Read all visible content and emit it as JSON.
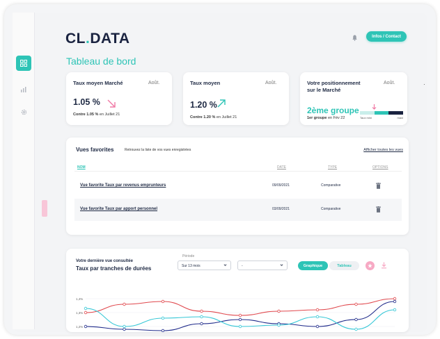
{
  "brand": {
    "logo_main": "CL",
    "logo_dot": ".",
    "logo_rest": "DATA"
  },
  "header": {
    "contact_label": "Infos / Contact"
  },
  "page": {
    "title": "Tableau de bord"
  },
  "sidebar": {
    "items": [
      {
        "icon": "grid-icon",
        "active": true
      },
      {
        "icon": "bar-chart-icon",
        "active": false
      },
      {
        "icon": "gear-icon",
        "active": false
      }
    ]
  },
  "kpis": [
    {
      "title": "Taux moyen Marché",
      "month": "Août.",
      "value": "1.05 %",
      "trend": "down",
      "sub_bold": "Contre 1.05 %",
      "sub_rest": " en Juillet 21"
    },
    {
      "title": "Taux moyen",
      "month": "Août.",
      "value": "1.20 %",
      "trend": "up",
      "sub_bold": "Contre 1.20 %",
      "sub_rest": " en Juillet 21"
    }
  ],
  "position": {
    "title": "Votre positionnement sur le Marché",
    "month": "Août.",
    "rank": "2ème groupe",
    "sub_bold": "1er groupe",
    "sub_rest": " en Fév 22",
    "bar_min": "Taux mini",
    "bar_max": "maxi"
  },
  "favorites": {
    "title": "Vues favorites",
    "description": "Retrouvez la liste de vos vues enregistrées",
    "show_all": "Afficher toutes les vues",
    "columns": [
      "NOM",
      "DATE",
      "TYPE",
      "OPTIONS"
    ],
    "rows": [
      {
        "name": "Vue favorite Taux par revenus emprunteurs",
        "date": "09/09/2021",
        "type": "Comparative"
      },
      {
        "name": "Vue favorite Taux par apport personnel",
        "date": "03/09/2021",
        "type": "Comparative"
      }
    ]
  },
  "last_view": {
    "subtitle": "Votre dernière vue consultée",
    "title": "Taux par tranches de durées",
    "period_label": "Période",
    "period_value": "Sur 13 mois",
    "second_value": "-",
    "graph_label": "Graphique",
    "table_label": "Tableau"
  },
  "colors": {
    "accent": "#2ec4b6",
    "pink": "#f7a9c4",
    "red": "#e0474c",
    "navy": "#1f2a8a",
    "cyan": "#35c7d6"
  },
  "chart_data": {
    "type": "line",
    "y_tick_labels": [
      "1,4%",
      "1,3%",
      "1,2%"
    ],
    "series": [
      {
        "color": "#e0474c",
        "values": [
          1.3,
          1.36,
          1.38,
          1.31,
          1.28,
          1.31,
          1.32,
          1.36,
          1.4
        ]
      },
      {
        "color": "#1f2a8a",
        "values": [
          1.2,
          1.18,
          1.17,
          1.22,
          1.25,
          1.22,
          1.2,
          1.25,
          1.38
        ]
      },
      {
        "color": "#35c7d6",
        "values": [
          1.33,
          1.2,
          1.26,
          1.27,
          1.2,
          1.21,
          1.27,
          1.18,
          1.32
        ]
      }
    ],
    "ylim": [
      1.15,
      1.45
    ]
  }
}
